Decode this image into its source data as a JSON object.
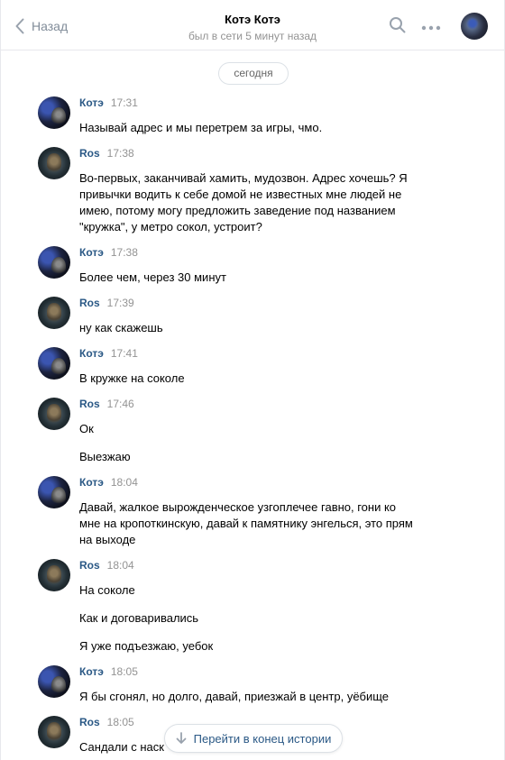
{
  "header": {
    "back_label": "Назад",
    "title": "Котэ Котэ",
    "subtitle": "был в сети 5 минут назад"
  },
  "date_divider": "сегодня",
  "messages": [
    {
      "author": "Котэ",
      "time": "17:31",
      "avatar": "kote",
      "lines": [
        "Называй адрес и мы перетрем за игры, чмо."
      ]
    },
    {
      "author": "Ros",
      "time": "17:38",
      "avatar": "ros",
      "lines": [
        "Во-первых, заканчивай хамить, мудозвон. Адрес хочешь? Я",
        "привычки водить к себе домой не известных мне людей не",
        "имею, потому могу предложить заведение под названием",
        "\"кружка\", у метро сокол, устроит?"
      ]
    },
    {
      "author": "Котэ",
      "time": "17:38",
      "avatar": "kote",
      "lines": [
        "Более чем, через 30 минут"
      ]
    },
    {
      "author": "Ros",
      "time": "17:39",
      "avatar": "ros",
      "lines": [
        "ну как скажешь"
      ]
    },
    {
      "author": "Котэ",
      "time": "17:41",
      "avatar": "kote",
      "lines": [
        "В кружке на соколе"
      ]
    },
    {
      "author": "Ros",
      "time": "17:46",
      "avatar": "ros",
      "lines": [
        "Ок",
        "Выезжаю"
      ]
    },
    {
      "author": "Котэ",
      "time": "18:04",
      "avatar": "kote",
      "lines": [
        "Давай, жалкое вырожденческое узгоплечее гавно, гони ко",
        "мне на кропоткинскую, давай к памятнику энгелься, это прям",
        "на выходе"
      ]
    },
    {
      "author": "Ros",
      "time": "18:04",
      "avatar": "ros",
      "lines": [
        "На соколе",
        "Как и договаривались",
        "Я уже подъезжаю, уебок"
      ]
    },
    {
      "author": "Котэ",
      "time": "18:05",
      "avatar": "kote",
      "lines": [
        "Я бы сгонял, но долго, давай, приезжай в центр, уёбище"
      ]
    },
    {
      "author": "Ros",
      "time": "18:05",
      "avatar": "ros",
      "lines": [
        "Сандали с наск"
      ]
    }
  ],
  "jump_button": {
    "label": "Перейти в конец истории",
    "icon": "arrow-down-icon"
  },
  "icons": {
    "back": "chevron-left-icon",
    "search": "search-icon",
    "more": "more-dots-icon"
  },
  "colors": {
    "author": "#2a5885",
    "muted": "#939393",
    "accent_icon": "#99a2ad"
  }
}
